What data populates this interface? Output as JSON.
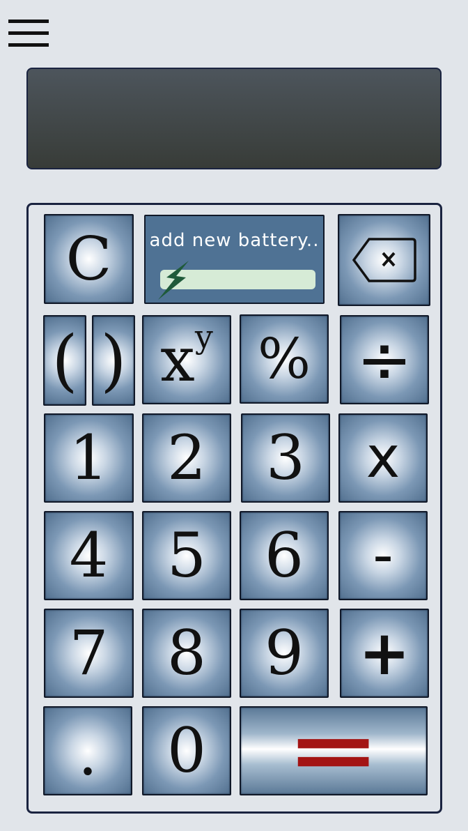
{
  "menu": {
    "icon": "hamburger-menu-icon"
  },
  "display": {
    "value": ""
  },
  "battery": {
    "label": "add new battery..",
    "level_fraction": 0,
    "icon": "lightning-bolt-icon",
    "bar_color": "#d6ebd6",
    "bolt_color": "#1f5a3a"
  },
  "keys": {
    "clear": "C",
    "backspace_icon": "backspace-icon",
    "paren_open": "(",
    "paren_close": ")",
    "power_base": "x",
    "power_exp": "y",
    "percent": "%",
    "divide": "÷",
    "one": "1",
    "two": "2",
    "three": "3",
    "multiply": "x",
    "four": "4",
    "five": "5",
    "six": "6",
    "minus": "-",
    "seven": "7",
    "eight": "8",
    "nine": "9",
    "plus": "+",
    "dot": ".",
    "zero": "0",
    "equals": "="
  },
  "colors": {
    "equals_sign": "#a31414",
    "key_edge": "#52708f",
    "frame": "#1a2340"
  }
}
